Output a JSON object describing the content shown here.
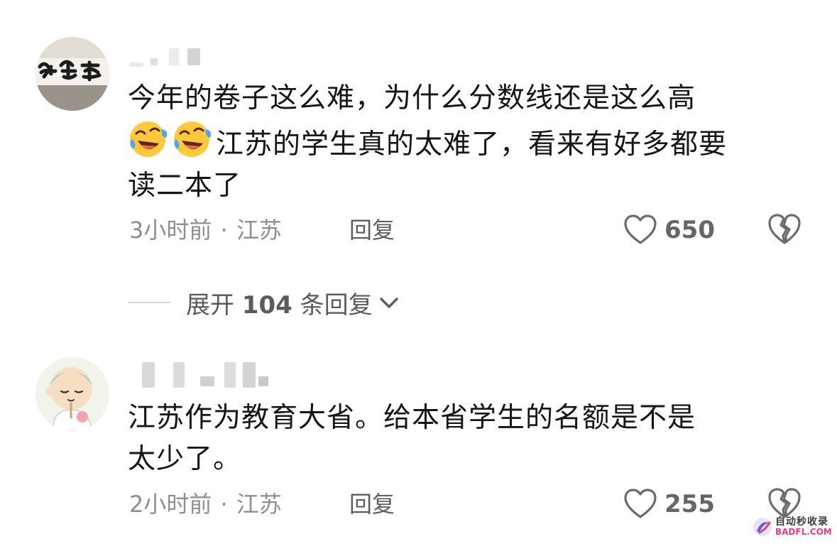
{
  "comments": [
    {
      "text_line1": "今年的卷子这么难，为什么分数线还是这么高",
      "emoji_name": "rolling-on-floor-laughing-emoji",
      "text_line2": "江苏的学生真的太难了，看来有好多都要",
      "text_line3": "读二本了",
      "time": "3小时前",
      "separator": "·",
      "location": "江苏",
      "reply_label": "回复",
      "like_count": "650",
      "avatar_icon": "calligraphy-avatar"
    },
    {
      "text_line1": "江苏作为教育大省。给本省学生的名额是不是",
      "text_line2": "太少了。",
      "time": "2小时前",
      "separator": "·",
      "location": "江苏",
      "reply_label": "回复",
      "like_count": "255",
      "avatar_icon": "cartoon-monk-avatar"
    }
  ],
  "expand_replies": {
    "label_prefix": "展开",
    "count": "104",
    "label_suffix": "条回复"
  },
  "watermark": {
    "line1": "自动秒收录",
    "line2": "BADFL.COM"
  },
  "colors": {
    "text": "#161616",
    "meta": "#8e8e8e",
    "icon": "#6b6b6b"
  }
}
